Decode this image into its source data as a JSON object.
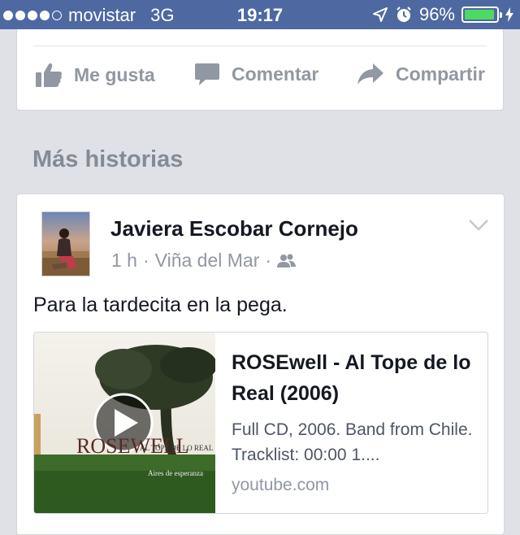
{
  "status_bar": {
    "carrier": "movistar",
    "network": "3G",
    "time": "19:17",
    "battery_percent": "96%",
    "battery_level": 0.96,
    "signal_bars": 4,
    "icons": [
      "location-arrow-icon",
      "alarm-icon",
      "battery-icon"
    ]
  },
  "prev_post_actions": {
    "like_label": "Me gusta",
    "comment_label": "Comentar",
    "share_label": "Compartir"
  },
  "section": {
    "title": "Más historias"
  },
  "story": {
    "author": "Javiera Escobar Cornejo",
    "time": "1 h",
    "location": "Viña del Mar",
    "separator": "·",
    "audience_icon": "friends-icon",
    "text": "Para la tardecita en la pega.",
    "link": {
      "thumb_brand": "ROSEWELL",
      "thumb_subtitle": "AL TOPE DE LO REAL",
      "thumb_caption": "Aires de esperanza",
      "title": "ROSEwell - Al Tope de lo Real (2006)",
      "description": "Full CD, 2006. Band from Chile. Tracklist: 00:00 1....",
      "domain": "youtube.com"
    }
  },
  "colors": {
    "status_bar_bg": "#4e69a2",
    "feed_bg": "#dfe1e6",
    "action_gray": "#9197a3",
    "battery_green": "#4cd964"
  }
}
